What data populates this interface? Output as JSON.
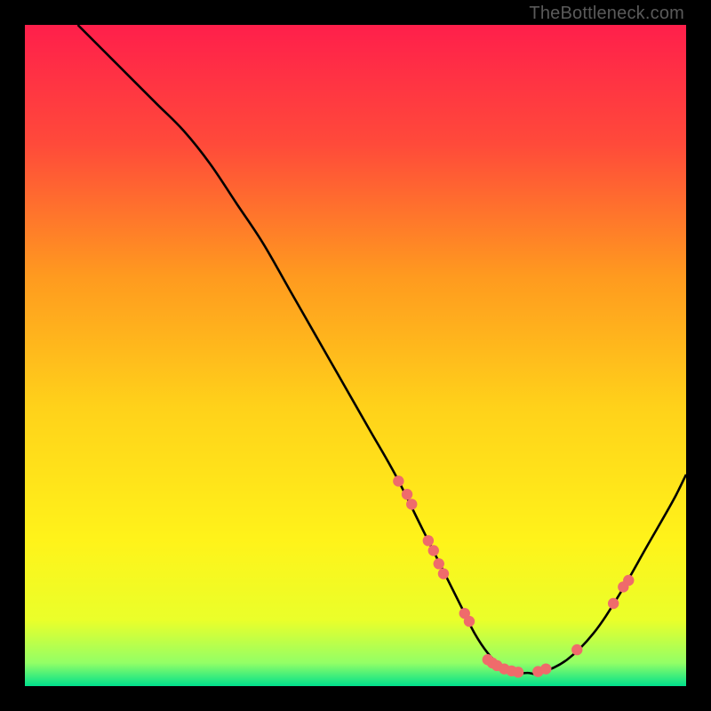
{
  "watermark": "TheBottleneck.com",
  "chart_data": {
    "type": "line",
    "title": "",
    "xlabel": "",
    "ylabel": "",
    "xlim": [
      0,
      100
    ],
    "ylim": [
      0,
      100
    ],
    "grid": false,
    "legend": false,
    "gradient_stops": [
      {
        "offset": 0.0,
        "color": "#ff1f4b"
      },
      {
        "offset": 0.18,
        "color": "#ff4a3a"
      },
      {
        "offset": 0.38,
        "color": "#ff9a1f"
      },
      {
        "offset": 0.58,
        "color": "#ffd21a"
      },
      {
        "offset": 0.78,
        "color": "#fff31a"
      },
      {
        "offset": 0.9,
        "color": "#eaff2a"
      },
      {
        "offset": 0.965,
        "color": "#93ff66"
      },
      {
        "offset": 1.0,
        "color": "#00e08c"
      }
    ],
    "series": [
      {
        "name": "bottleneck-curve",
        "color": "#000000",
        "x": [
          8,
          12,
          16,
          20,
          24,
          28,
          32,
          36,
          40,
          44,
          48,
          52,
          56,
          60,
          62,
          64,
          66,
          68,
          70,
          72,
          74,
          76,
          78,
          82,
          86,
          90,
          94,
          98,
          100
        ],
        "y": [
          100,
          96,
          92,
          88,
          84,
          79,
          73,
          67,
          60,
          53,
          46,
          39,
          32,
          24,
          20,
          16,
          12,
          8,
          5,
          3,
          2,
          2,
          2,
          4,
          8,
          14,
          21,
          28,
          32
        ]
      }
    ],
    "markers": {
      "color": "#ef6b6b",
      "radius": 6.2,
      "points": [
        {
          "x": 56.5,
          "y": 31
        },
        {
          "x": 57.8,
          "y": 29
        },
        {
          "x": 58.5,
          "y": 27.5
        },
        {
          "x": 61.0,
          "y": 22
        },
        {
          "x": 61.8,
          "y": 20.5
        },
        {
          "x": 62.6,
          "y": 18.5
        },
        {
          "x": 63.3,
          "y": 17
        },
        {
          "x": 66.5,
          "y": 11
        },
        {
          "x": 67.2,
          "y": 9.8
        },
        {
          "x": 70.0,
          "y": 4
        },
        {
          "x": 70.7,
          "y": 3.5
        },
        {
          "x": 71.4,
          "y": 3.1
        },
        {
          "x": 72.5,
          "y": 2.6
        },
        {
          "x": 73.6,
          "y": 2.3
        },
        {
          "x": 74.6,
          "y": 2.1
        },
        {
          "x": 77.6,
          "y": 2.2
        },
        {
          "x": 78.8,
          "y": 2.6
        },
        {
          "x": 83.5,
          "y": 5.5
        },
        {
          "x": 89.0,
          "y": 12.5
        },
        {
          "x": 90.5,
          "y": 15
        },
        {
          "x": 91.3,
          "y": 16
        }
      ]
    }
  }
}
